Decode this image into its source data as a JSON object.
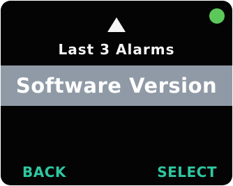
{
  "status": {
    "indicator_icon": "status-dot-icon",
    "indicator_color": "#5cc85a"
  },
  "menu": {
    "scroll_up_icon": "up-arrow-icon",
    "previous_item": "Last 3 Alarms",
    "selected_item": "Software Version",
    "selection_color": "#8f9aa6"
  },
  "softkeys": {
    "left_label": "BACK",
    "right_label": "SELECT",
    "color": "#2fc6a0"
  }
}
